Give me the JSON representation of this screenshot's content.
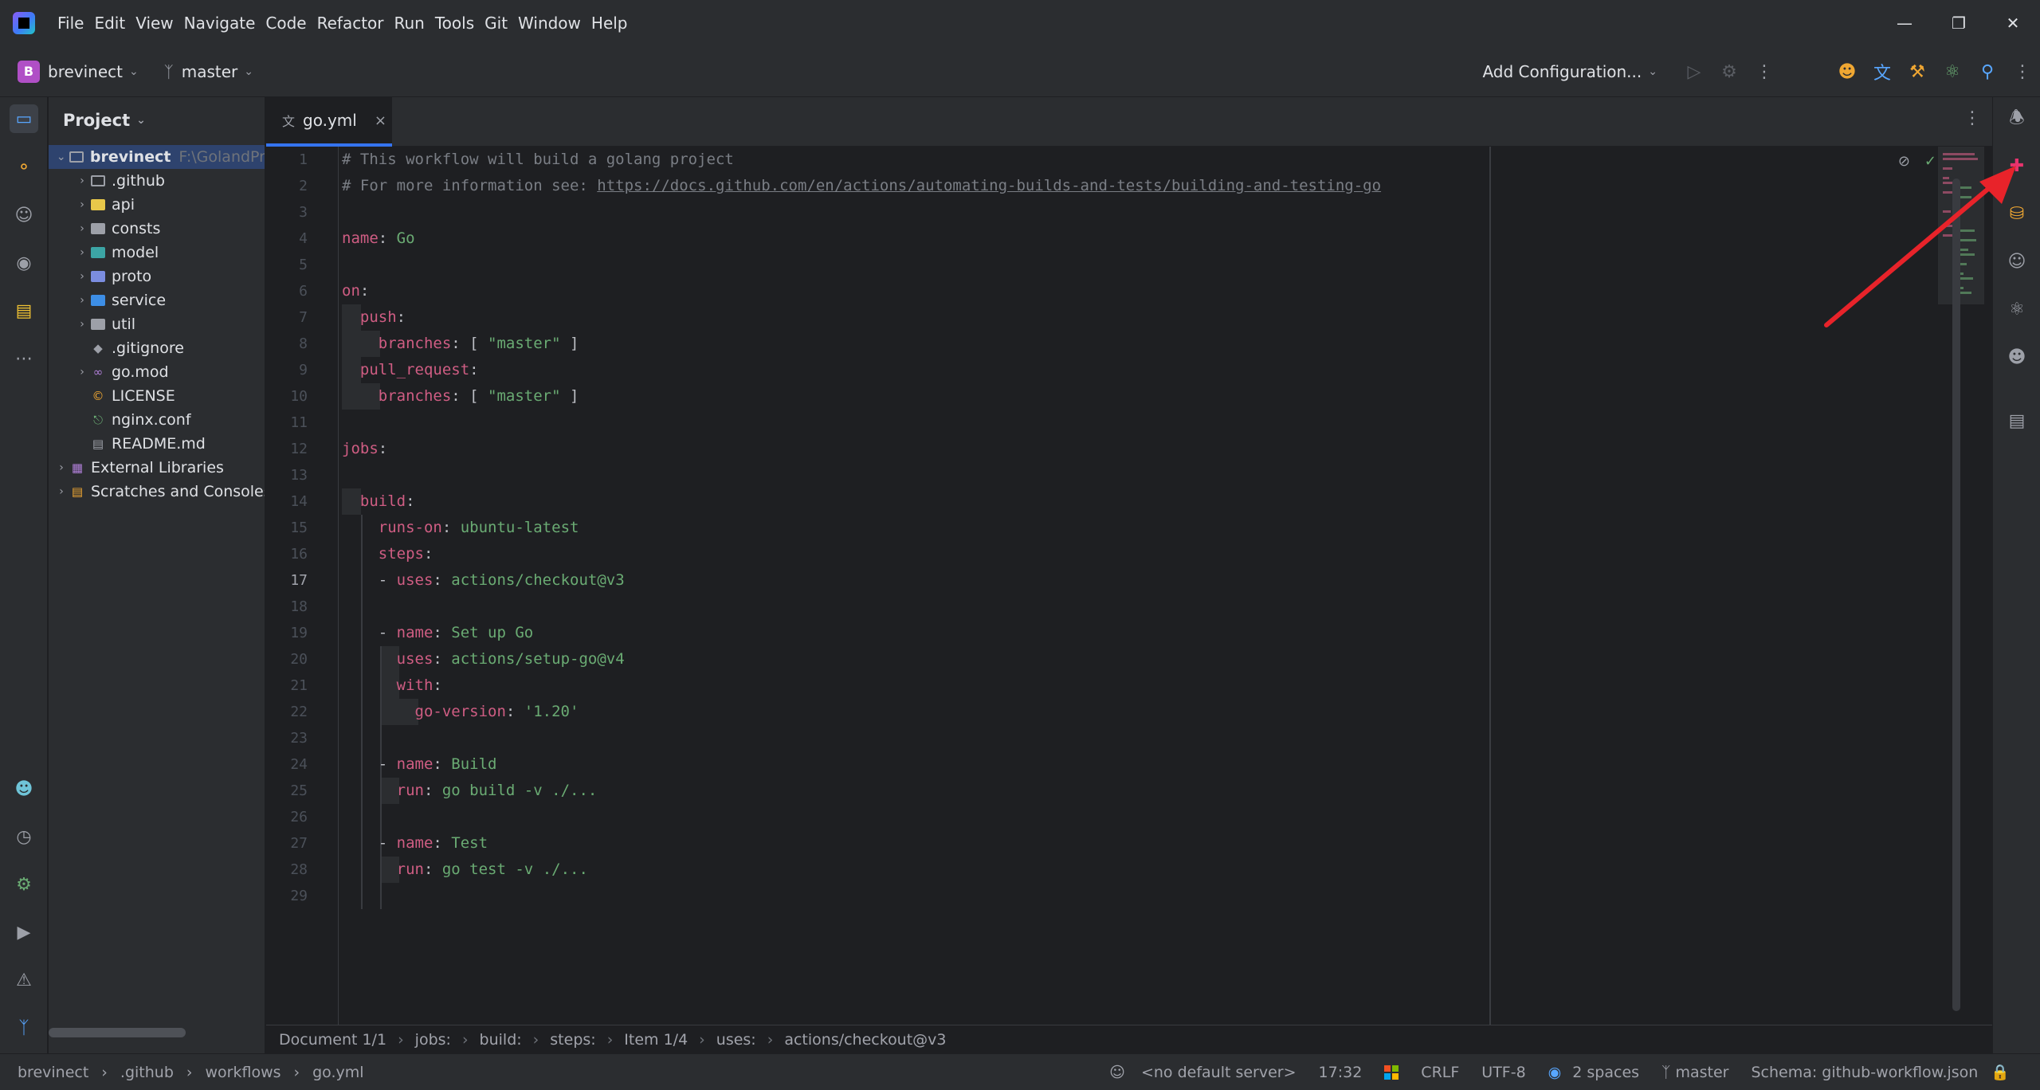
{
  "menu": [
    "File",
    "Edit",
    "View",
    "Navigate",
    "Code",
    "Refactor",
    "Run",
    "Tools",
    "Git",
    "Window",
    "Help"
  ],
  "toolbar": {
    "project_initial": "B",
    "project_name": "brevinect",
    "branch": "master",
    "run_config": "Add Configuration..."
  },
  "project_panel": {
    "title": "Project",
    "root": {
      "name": "brevinect",
      "path": "F:\\GolandPr"
    },
    "items": [
      ".github",
      "api",
      "consts",
      "model",
      "proto",
      "service",
      "util",
      ".gitignore",
      "go.mod",
      "LICENSE",
      "nginx.conf",
      "README.md"
    ],
    "external": "External Libraries",
    "scratches": "Scratches and Consoles"
  },
  "tab": {
    "label": "go.yml"
  },
  "editor": {
    "current_line": 17,
    "lines": [
      {
        "n": "1",
        "tokens": [
          [
            "cmt",
            "# This workflow will build a golang project"
          ]
        ]
      },
      {
        "n": "2",
        "tokens": [
          [
            "cmt",
            "# For more information see: "
          ],
          [
            "link",
            "https://docs.github.com/en/actions/automating-builds-and-tests/building-and-testing-go"
          ]
        ]
      },
      {
        "n": "3",
        "tokens": []
      },
      {
        "n": "4",
        "tokens": [
          [
            "key",
            "name"
          ],
          [
            "punc",
            ": "
          ],
          [
            "val",
            "Go"
          ]
        ]
      },
      {
        "n": "5",
        "tokens": []
      },
      {
        "n": "6",
        "tokens": [
          [
            "key",
            "on"
          ],
          [
            "punc",
            ":"
          ]
        ]
      },
      {
        "n": "7",
        "tokens": [
          [
            "punc",
            "  "
          ],
          [
            "key",
            "push"
          ],
          [
            "punc",
            ":"
          ]
        ]
      },
      {
        "n": "8",
        "tokens": [
          [
            "punc",
            "    "
          ],
          [
            "key",
            "branches"
          ],
          [
            "punc",
            ": [ "
          ],
          [
            "val",
            "\"master\""
          ],
          [
            "punc",
            " ]"
          ]
        ]
      },
      {
        "n": "9",
        "tokens": [
          [
            "punc",
            "  "
          ],
          [
            "key",
            "pull_request"
          ],
          [
            "punc",
            ":"
          ]
        ]
      },
      {
        "n": "10",
        "tokens": [
          [
            "punc",
            "    "
          ],
          [
            "key",
            "branches"
          ],
          [
            "punc",
            ": [ "
          ],
          [
            "val",
            "\"master\""
          ],
          [
            "punc",
            " ]"
          ]
        ]
      },
      {
        "n": "11",
        "tokens": []
      },
      {
        "n": "12",
        "tokens": [
          [
            "key",
            "jobs"
          ],
          [
            "punc",
            ":"
          ]
        ]
      },
      {
        "n": "13",
        "tokens": []
      },
      {
        "n": "14",
        "tokens": [
          [
            "punc",
            "  "
          ],
          [
            "key",
            "build"
          ],
          [
            "punc",
            ":"
          ]
        ]
      },
      {
        "n": "15",
        "tokens": [
          [
            "punc",
            "    "
          ],
          [
            "key",
            "runs-on"
          ],
          [
            "punc",
            ": "
          ],
          [
            "val",
            "ubuntu-latest"
          ]
        ]
      },
      {
        "n": "16",
        "tokens": [
          [
            "punc",
            "    "
          ],
          [
            "key",
            "steps"
          ],
          [
            "punc",
            ":"
          ]
        ]
      },
      {
        "n": "17",
        "tokens": [
          [
            "punc",
            "    - "
          ],
          [
            "key",
            "uses"
          ],
          [
            "punc",
            ": "
          ],
          [
            "val",
            "actions/checkout@v3"
          ]
        ]
      },
      {
        "n": "18",
        "tokens": []
      },
      {
        "n": "19",
        "tokens": [
          [
            "punc",
            "    - "
          ],
          [
            "key",
            "name"
          ],
          [
            "punc",
            ": "
          ],
          [
            "val",
            "Set up Go"
          ]
        ]
      },
      {
        "n": "20",
        "tokens": [
          [
            "punc",
            "      "
          ],
          [
            "key",
            "uses"
          ],
          [
            "punc",
            ": "
          ],
          [
            "val",
            "actions/setup-go@v4"
          ]
        ]
      },
      {
        "n": "21",
        "tokens": [
          [
            "punc",
            "      "
          ],
          [
            "key",
            "with"
          ],
          [
            "punc",
            ":"
          ]
        ]
      },
      {
        "n": "22",
        "tokens": [
          [
            "punc",
            "        "
          ],
          [
            "key",
            "go-version"
          ],
          [
            "punc",
            ": "
          ],
          [
            "val",
            "'1.20'"
          ]
        ]
      },
      {
        "n": "23",
        "tokens": []
      },
      {
        "n": "24",
        "tokens": [
          [
            "punc",
            "    - "
          ],
          [
            "key",
            "name"
          ],
          [
            "punc",
            ": "
          ],
          [
            "val",
            "Build"
          ]
        ]
      },
      {
        "n": "25",
        "tokens": [
          [
            "punc",
            "      "
          ],
          [
            "key",
            "run"
          ],
          [
            "punc",
            ": "
          ],
          [
            "val",
            "go build -v ./..."
          ]
        ]
      },
      {
        "n": "26",
        "tokens": []
      },
      {
        "n": "27",
        "tokens": [
          [
            "punc",
            "    - "
          ],
          [
            "key",
            "name"
          ],
          [
            "punc",
            ": "
          ],
          [
            "val",
            "Test"
          ]
        ]
      },
      {
        "n": "28",
        "tokens": [
          [
            "punc",
            "      "
          ],
          [
            "key",
            "run"
          ],
          [
            "punc",
            ": "
          ],
          [
            "val",
            "go test -v ./..."
          ]
        ]
      },
      {
        "n": "29",
        "tokens": []
      }
    ]
  },
  "editor_breadcrumbs": [
    "Document 1/1",
    "jobs:",
    "build:",
    "steps:",
    "Item 1/4",
    "uses:",
    "actions/checkout@v3"
  ],
  "status": {
    "path": [
      "brevinect",
      ".github",
      "workflows",
      "go.yml"
    ],
    "server": "<no default server>",
    "position": "17:32",
    "line_sep": "CRLF",
    "encoding": "UTF-8",
    "indent": "2 spaces",
    "branch": "master",
    "schema": "Schema: github-workflow.json"
  },
  "colors": {
    "accent": "#3574f0",
    "key": "#cf5d83",
    "value": "#6aab73",
    "comment": "#7a7e85",
    "annotation_arrow": "#e8232a"
  }
}
